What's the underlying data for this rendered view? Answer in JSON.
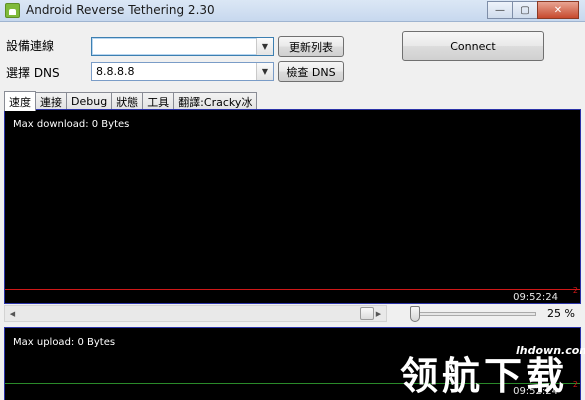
{
  "window": {
    "title": "Android Reverse Tethering 2.30",
    "controls": [
      "—",
      "▢",
      "✕"
    ]
  },
  "form": {
    "device_label": "設備連線",
    "device_value": "",
    "refresh_button": "更新列表",
    "dns_label": "選擇 DNS",
    "dns_value": "8.8.8.8",
    "check_dns_button": "檢查 DNS",
    "connect_button": "Connect"
  },
  "tabs": [
    {
      "label": "速度",
      "selected": true
    },
    {
      "label": "連接",
      "selected": false
    },
    {
      "label": "Debug",
      "selected": false
    },
    {
      "label": "狀態",
      "selected": false
    },
    {
      "label": "工具",
      "selected": false
    },
    {
      "label": "翻譯:Cracky冰",
      "selected": false
    }
  ],
  "download_panel": {
    "label": "Max download: 0 Bytes",
    "time": "09:52:24",
    "marker": "2"
  },
  "upload_panel": {
    "label": "Max upload: 0 Bytes",
    "time": "09:52:24",
    "marker": "2"
  },
  "zoom": {
    "value": 0.25,
    "label": "25 %"
  },
  "watermark": {
    "site": "lhdown.com",
    "text": "领航下载"
  },
  "colors": {
    "graph_bg": "#000000",
    "download_line": "#d01818",
    "upload_line": "#2a8a2a",
    "panel_border": "#2b33a8"
  }
}
